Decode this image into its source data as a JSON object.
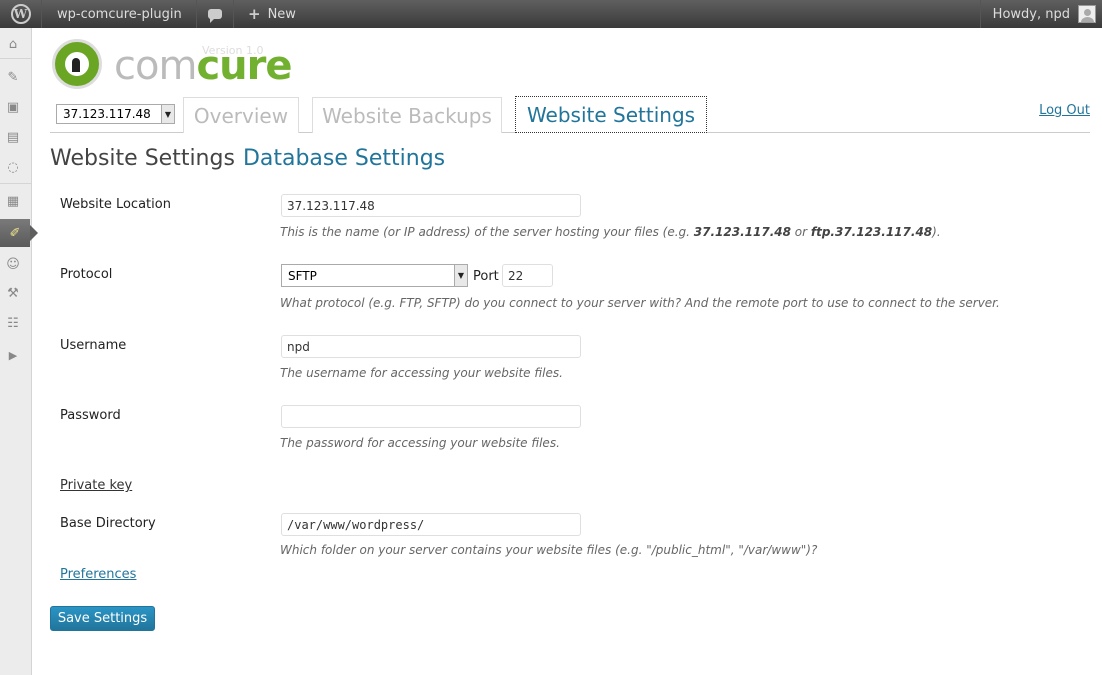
{
  "adminbar": {
    "site_name": "wp-comcure-plugin",
    "new_label": "New",
    "howdy": "Howdy, npd"
  },
  "plugin": {
    "logo_com": "com",
    "logo_cure": "cure",
    "version": "Version 1.0"
  },
  "tabs": {
    "server_selected": "37.123.117.48",
    "overview": "Overview",
    "backups": "Website Backups",
    "settings": "Website Settings",
    "logout": "Log Out"
  },
  "page": {
    "title": "Website Settings",
    "subtitle": "Database Settings"
  },
  "form": {
    "location_label": "Website Location",
    "location_value": "37.123.117.48",
    "location_help_pre": "This is the name (or IP address) of the server hosting your files (e.g. ",
    "location_help_ex1": "37.123.117.48",
    "location_help_or": " or ",
    "location_help_ex2": "ftp.37.123.117.48",
    "location_help_post": ").",
    "protocol_label": "Protocol",
    "protocol_value": "SFTP",
    "port_label": "Port",
    "port_value": "22",
    "protocol_help": "What protocol (e.g. FTP, SFTP) do you connect to your server with? And the remote port to use to connect to the server.",
    "username_label": "Username",
    "username_value": "npd",
    "username_help": "The username for accessing your website files.",
    "password_label": "Password",
    "password_value": "",
    "password_help": "The password for accessing your website files.",
    "private_key_link": "Private key",
    "basedir_label": "Base Directory",
    "basedir_value": "/var/www/wordpress/",
    "basedir_help": "Which folder on your server contains your website files (e.g. \"/public_html\", \"/var/www\")?",
    "preferences_link": "Preferences",
    "save_button": "Save Settings"
  },
  "colors": {
    "accent": "#21759b",
    "brand_green": "#72b030",
    "adminbar": "#464646"
  },
  "icons": [
    "wordpress-icon",
    "comment-icon",
    "plus-icon",
    "dashboard-icon",
    "pin-icon",
    "media-icon",
    "pages-icon",
    "comments-menu-icon",
    "appearance-icon",
    "plugins-icon",
    "users-icon",
    "tools-icon",
    "settings-icon",
    "collapse-icon"
  ]
}
